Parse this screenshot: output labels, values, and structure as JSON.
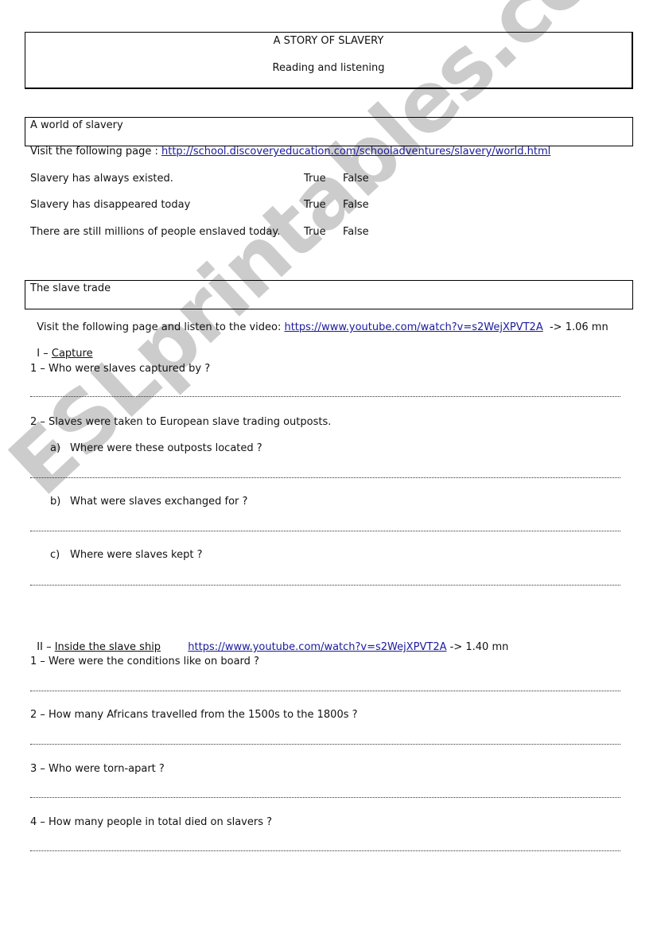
{
  "header": {
    "title": "A STORY OF SLAVERY",
    "subtitle": "Reading and listening"
  },
  "section1": {
    "heading": "A world of slavery",
    "visit_prefix": "Visit the following page : ",
    "visit_link": "http://school.discoveryeducation.com/schooladventures/slavery/world.html",
    "statements": [
      {
        "text": "Slavery has always existed.",
        "true_label": "True",
        "false_label": "False"
      },
      {
        "text": "Slavery has disappeared today",
        "true_label": "True",
        "false_label": "False"
      },
      {
        "text": "There are still millions of people enslaved today.",
        "true_label": "True",
        "false_label": "False"
      }
    ]
  },
  "section2": {
    "heading": "The slave trade",
    "visit_prefix": "Visit the following page and listen to the video: ",
    "visit_link": "https://www.youtube.com/watch?v=s2WejXPVT2A",
    "visit_suffix": "  -> 1.06 mn",
    "part1": {
      "numeral": "I – ",
      "title": "Capture",
      "q1": "1 – Who were slaves captured by ?",
      "q2": "2 – Slaves were taken to European slave trading outposts.",
      "q2a_marker": "a)",
      "q2a": "Where were these outposts located ?",
      "q2b_marker": "b)",
      "q2b": "What were slaves exchanged for ?",
      "q2c_marker": "c)",
      "q2c": "Where were slaves kept ?"
    },
    "part2": {
      "numeral": "II – ",
      "title": "Inside the slave ship",
      "link": "https://www.youtube.com/watch?v=s2WejXPVT2A",
      "suffix": " -> 1.40 mn",
      "q1": "1 – Were were the conditions like on board ?",
      "q2": "2 – How many Africans travelled from the 1500s to the 1800s ?",
      "q3": "3 – Who were torn-apart ?",
      "q4": "4 – How many people in total died on slavers ?"
    }
  },
  "watermark": "ESLprintables.com"
}
